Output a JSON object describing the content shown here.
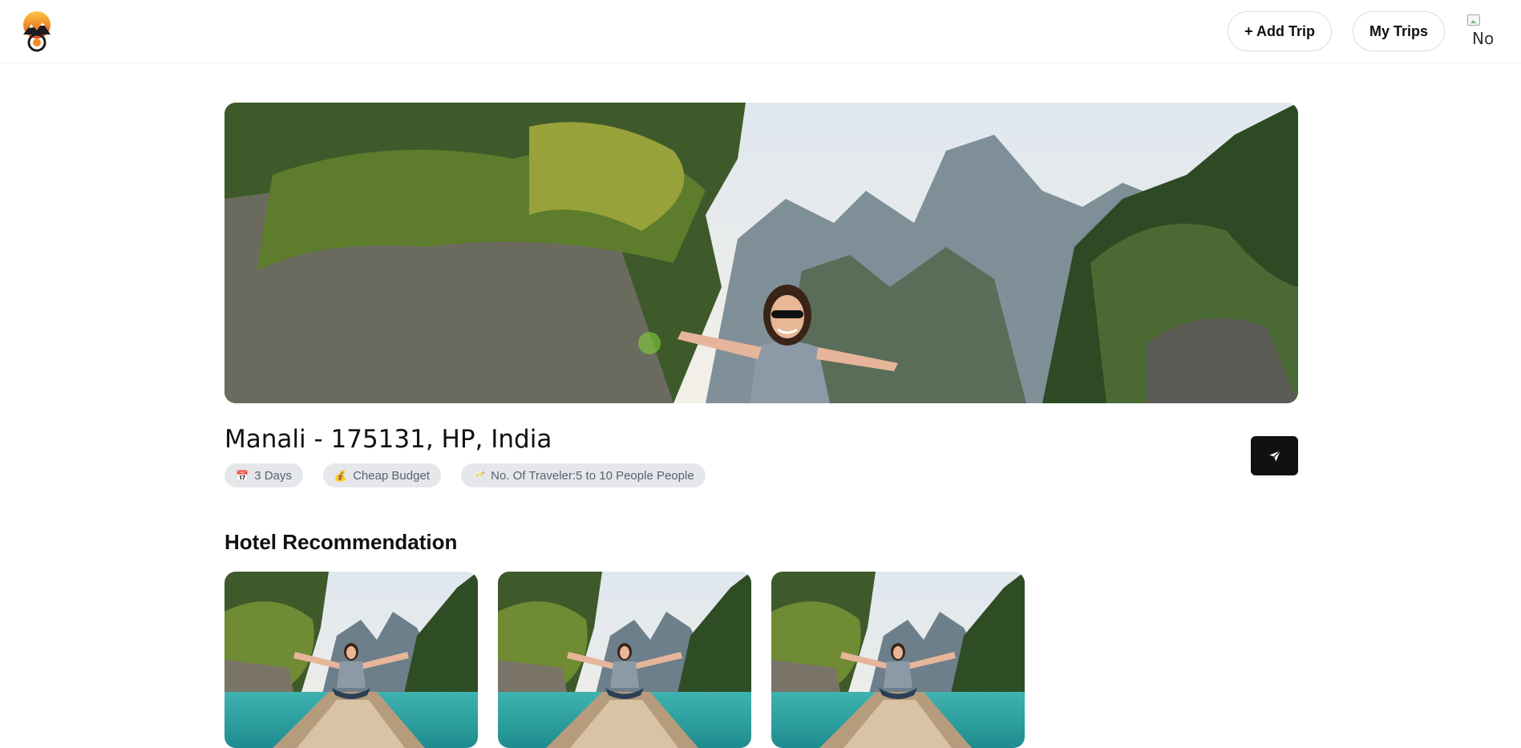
{
  "header": {
    "logo": "mountain-sunset-logo",
    "add_trip_label": "+ Add Trip",
    "my_trips_label": "My Trips",
    "avatar_alt": "No"
  },
  "trip": {
    "title": "Manali - 175131, HP, India",
    "tags": [
      {
        "icon": "calendar-icon",
        "label": "3 Days"
      },
      {
        "icon": "money-bag-icon",
        "label": "Cheap Budget"
      },
      {
        "icon": "clinking-glasses-icon",
        "label": "No. Of Traveler:5 to 10 People People"
      }
    ],
    "share_icon": "send-icon"
  },
  "hotels": {
    "section_title": "Hotel Recommendation",
    "items": [
      {
        "image": "traveler-boat-lagoon-photo"
      },
      {
        "image": "traveler-boat-lagoon-photo"
      },
      {
        "image": "traveler-boat-lagoon-photo"
      }
    ]
  },
  "colors": {
    "primary_button": "#111111",
    "tag_bg": "#e5e7eb",
    "tag_text": "#5b6270",
    "border": "#dcdcdc"
  }
}
